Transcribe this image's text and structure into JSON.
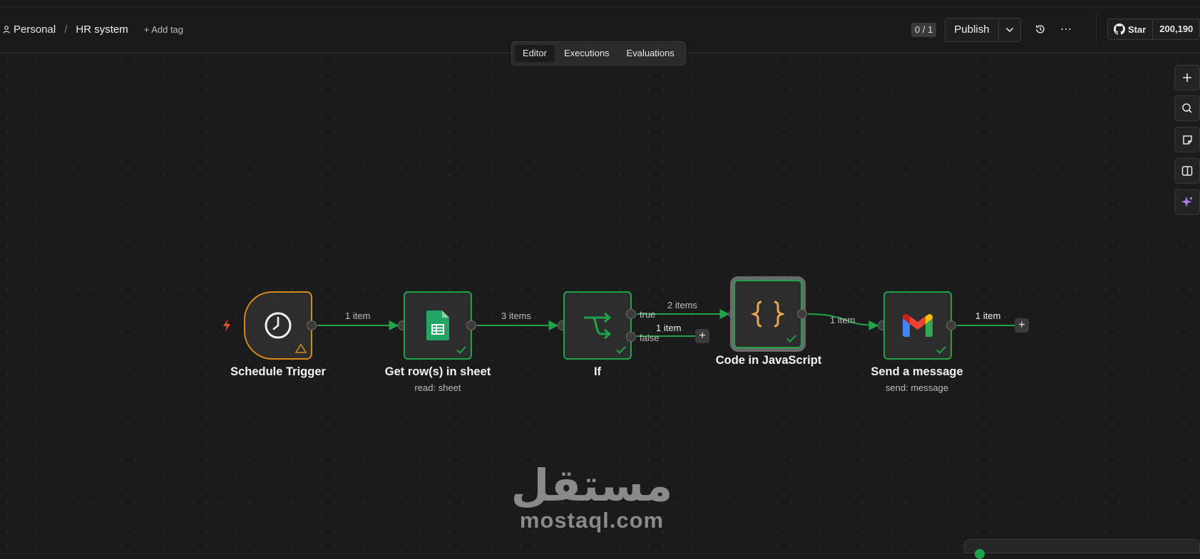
{
  "header": {
    "project": "Personal",
    "workflow_name": "HR system",
    "add_tag": "+ Add tag",
    "version_counter": "0 / 1",
    "publish_label": "Publish",
    "more_label": "⋯",
    "github_star_label": "Star",
    "github_star_count": "200,190"
  },
  "tabs": [
    {
      "label": "Editor",
      "active": true
    },
    {
      "label": "Executions",
      "active": false
    },
    {
      "label": "Evaluations",
      "active": false
    }
  ],
  "right_toolbar": [
    {
      "icon": "plus-icon"
    },
    {
      "icon": "search-icon"
    },
    {
      "icon": "sticky-note-icon"
    },
    {
      "icon": "panel-toggle-icon"
    },
    {
      "icon": "ai-sparkle-icon"
    }
  ],
  "nodes": [
    {
      "name": "Schedule Trigger",
      "subtitle": "",
      "icon": "clock-icon",
      "status": "warning"
    },
    {
      "name": "Get row(s) in sheet",
      "subtitle": "read: sheet",
      "icon": "google-sheets-icon",
      "status": "success"
    },
    {
      "name": "If",
      "subtitle": "",
      "icon": "branch-icon",
      "status": "success"
    },
    {
      "name": "Code in JavaScript",
      "subtitle": "",
      "icon": "code-braces-icon",
      "status": "success"
    },
    {
      "name": "Send a message",
      "subtitle": "send: message",
      "icon": "gmail-icon",
      "status": "success"
    }
  ],
  "connections": {
    "trigger_to_sheet": "1 item",
    "sheet_to_if": "3 items",
    "if_true_to_code": "2 items",
    "if_false_output": "1 item",
    "code_to_gmail": "1 item",
    "gmail_output": "1 item"
  },
  "if_outputs": {
    "true_label": "true",
    "false_label": "false"
  },
  "watermark": {
    "arabic": "مستقل",
    "latin": "mostaql.com"
  },
  "colors": {
    "success": "#1fa34a",
    "trigger": "#d58a1c",
    "warning": "#d58a1c",
    "background": "#1b1b1b",
    "sheets_green": "#23a566",
    "code_orange": "#f0a64a"
  }
}
